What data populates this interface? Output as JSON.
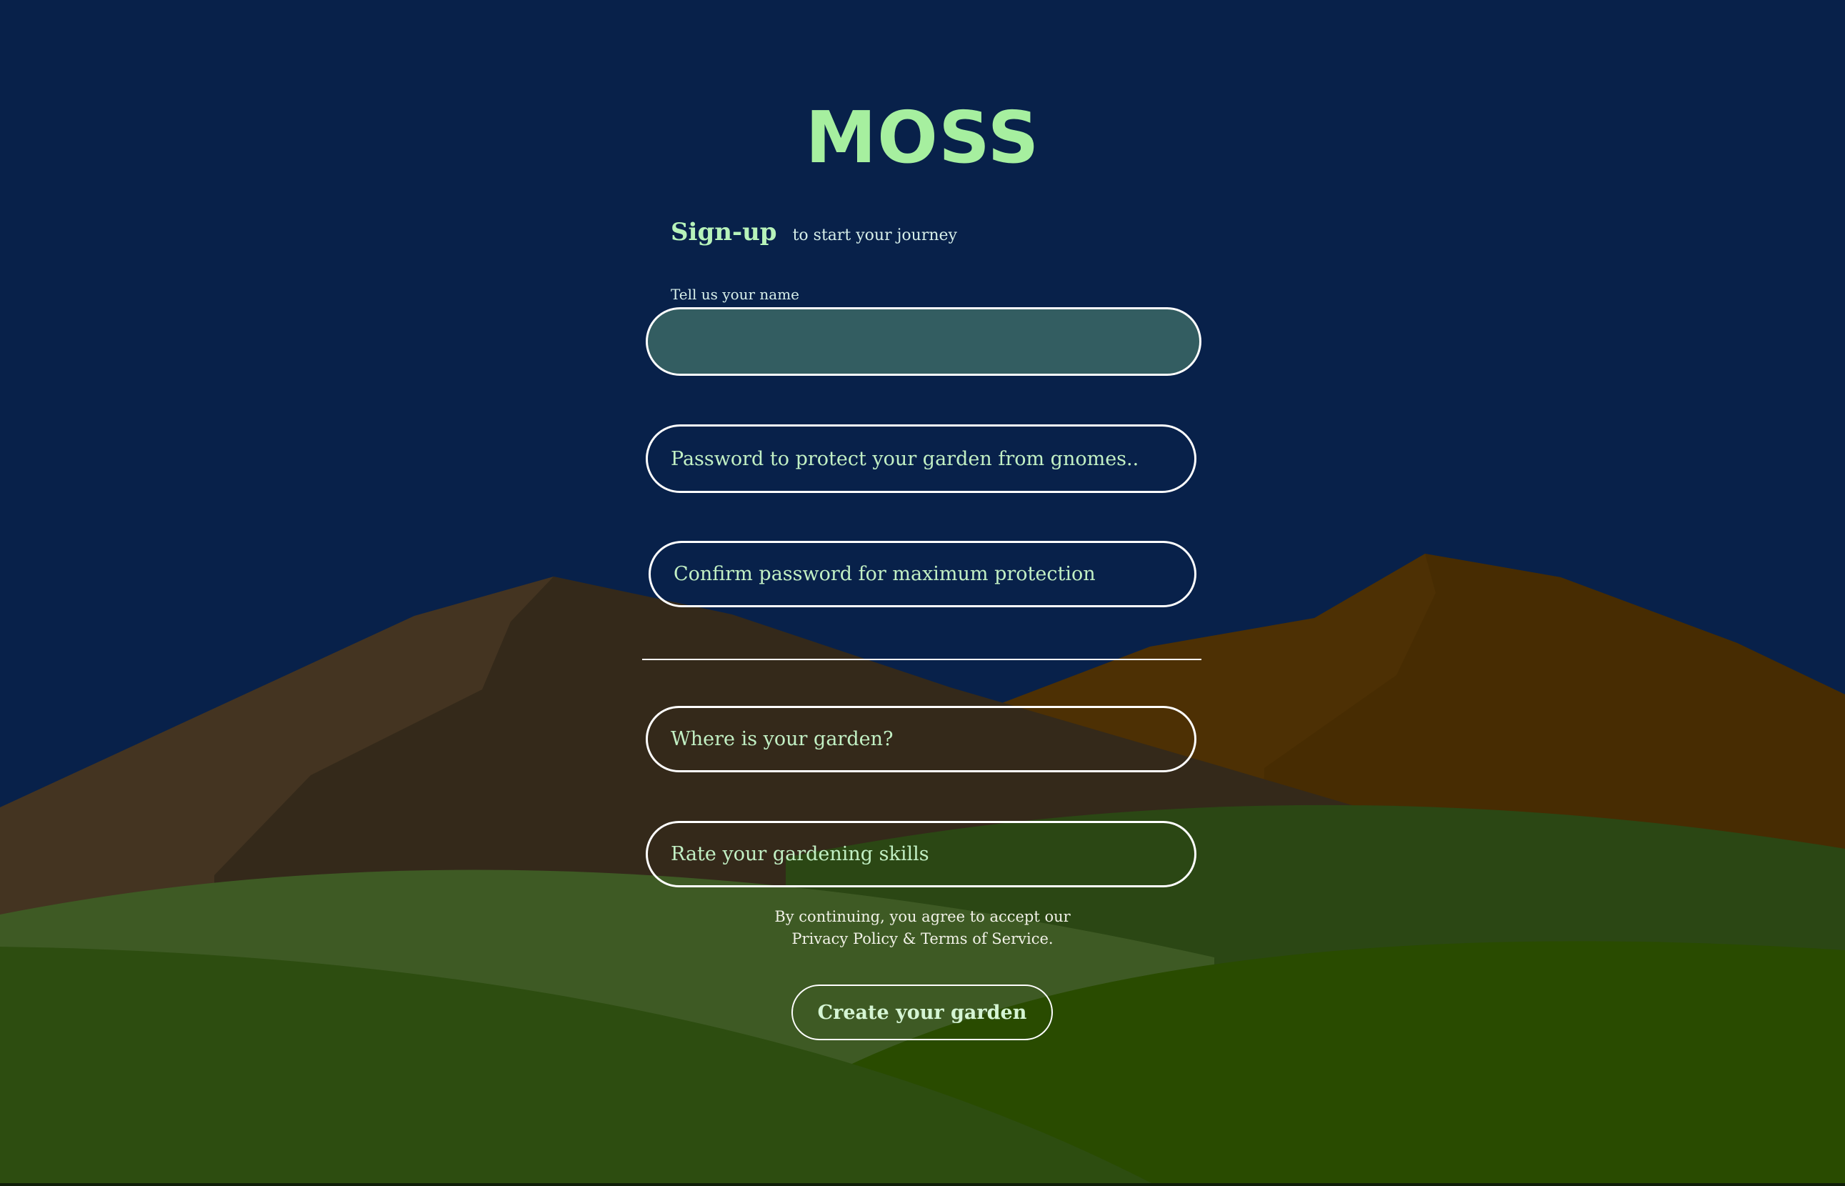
{
  "brand": {
    "name": "MOSS"
  },
  "signup": {
    "title": "Sign-up",
    "subtitle": "to start your journey"
  },
  "form": {
    "name_label": "Tell us your name",
    "name_value": "",
    "password_placeholder": "Password to protect your garden from gnomes..",
    "confirm_placeholder": "Confirm password for maximum protection",
    "location_placeholder": "Where is your garden?",
    "skills_placeholder": "Rate your gardening skills"
  },
  "terms": {
    "line1": "By continuing, you agree to accept our",
    "line2": "Privacy Policy & Terms of Service."
  },
  "actions": {
    "create_label": "Create your garden"
  },
  "colors": {
    "sky": "#08214a",
    "accent": "#a6ef9f",
    "field_fill": "#335d61",
    "border": "#ffffff"
  }
}
